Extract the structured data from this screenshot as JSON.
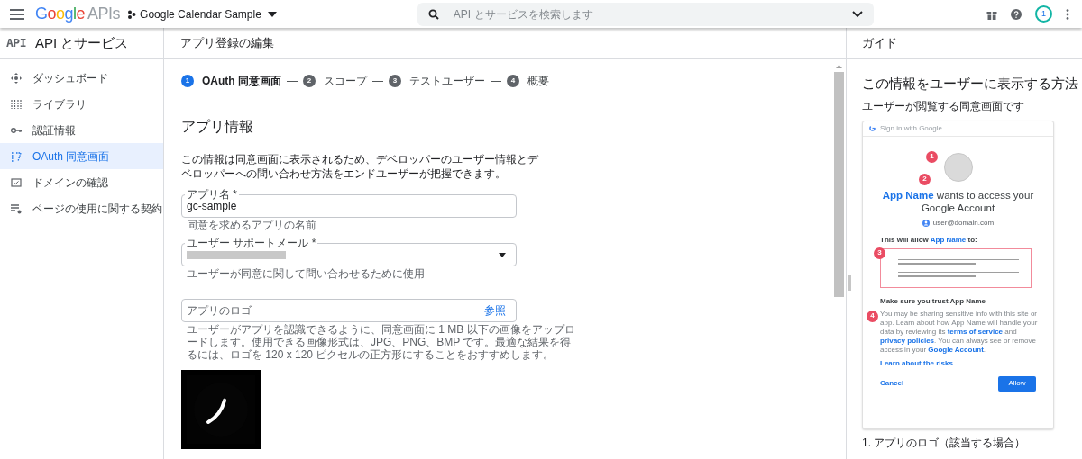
{
  "topbar": {
    "logo": {
      "brand": "Google",
      "suffix": "APIs"
    },
    "project": "Google Calendar Sample",
    "search": {
      "placeholder": "API とサービスを検索します"
    },
    "avatar": "1"
  },
  "sidebar": {
    "title": "API とサービス",
    "badge": "API",
    "items": [
      {
        "label": "ダッシュボード",
        "selected": false
      },
      {
        "label": "ライブラリ",
        "selected": false
      },
      {
        "label": "認証情報",
        "selected": false
      },
      {
        "label": "OAuth 同意画面",
        "selected": true
      },
      {
        "label": "ドメインの確認",
        "selected": false
      },
      {
        "label": "ページの使用に関する契約",
        "selected": false
      }
    ]
  },
  "main": {
    "title": "アプリ登録の編集",
    "steps": [
      {
        "number": "1",
        "label": "OAuth 同意画面",
        "selected": true
      },
      {
        "number": "2",
        "label": "スコープ",
        "selected": false
      },
      {
        "number": "3",
        "label": "テストユーザー",
        "selected": false
      },
      {
        "number": "4",
        "label": "概要",
        "selected": false
      }
    ],
    "separator": "—",
    "section_title": "アプリ情報",
    "description": "この情報は同意画面に表示されるため、デベロッパーのユーザー情報とデベロッパーへの問い合わせ方法をエンドユーザーが把握できます。",
    "fields": [
      {
        "kind": "text",
        "label": "アプリ名 *",
        "value": "gc-sample",
        "helper": "同意を求めるアプリの名前"
      },
      {
        "kind": "select",
        "label": "ユーザー サポートメール *",
        "helper": "ユーザーが同意に関して問い合わせるために使用"
      },
      {
        "kind": "file",
        "placeholder": "アプリのロゴ",
        "button": "参照",
        "helper": "ユーザーがアプリを認識できるように、同意画面に 1 MB 以下の画像をアップロードします。使用できる画像形式は、JPG、PNG、BMP です。最適な結果を得るには、ロゴを 120 x 120 ピクセルの正方形にすることをおすすめします。"
      }
    ]
  },
  "guide": {
    "title": "ガイド",
    "heading": "この情報をユーザーに表示する方法",
    "subheading": "ユーザーが閲覧する同意画面です",
    "preview": {
      "header": "Sign in with Google",
      "headline": [
        {
          "text": "App Name",
          "kind": "link"
        },
        {
          "text": " wants to access your Google Account",
          "kind": "plain"
        }
      ],
      "email": "user@domain.com",
      "allow_line": [
        {
          "text": "This will allow ",
          "kind": "plain"
        },
        {
          "text": "App Name",
          "kind": "link"
        },
        {
          "text": " to:",
          "kind": "plain"
        }
      ],
      "trust_title": "Make sure you trust App Name",
      "trust_text": [
        {
          "text": "You may be sharing sensitive info with this site or app. Learn about how App Name will handle your data by reviewing its ",
          "kind": "plain"
        },
        {
          "text": "terms of service",
          "kind": "link"
        },
        {
          "text": " and ",
          "kind": "plain"
        },
        {
          "text": "privacy policies",
          "kind": "link"
        },
        {
          "text": ". You can always see or remove access in your ",
          "kind": "plain"
        },
        {
          "text": "Google Account",
          "kind": "link"
        },
        {
          "text": ".",
          "kind": "plain"
        }
      ],
      "risks_link": "Learn about the risks",
      "cancel": "Cancel",
      "allow": "Allow",
      "markers": [
        "1",
        "2",
        "3",
        "4"
      ]
    },
    "list_item": "1. アプリのロゴ（該当する場合）"
  }
}
